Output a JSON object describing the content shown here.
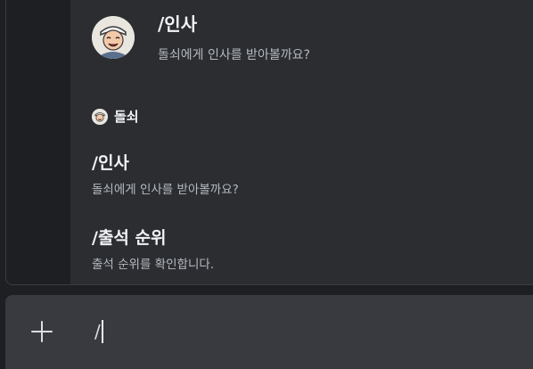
{
  "autocomplete": {
    "featured": {
      "command": "/인사",
      "description": "돌쇠에게 인사를 받아볼까요?",
      "avatar_icon": "bot-avatar-icon"
    },
    "bot": {
      "name": "돌쇠",
      "avatar_icon": "bot-avatar-icon"
    },
    "commands": [
      {
        "command": "/인사",
        "description": "돌쇠에게 인사를 받아볼까요?"
      },
      {
        "command": "/출석 순위",
        "description": "출석 순위를 확인합니다."
      }
    ]
  },
  "composer": {
    "add_icon": "plus-icon",
    "value": "/"
  },
  "colors": {
    "background": "#1e1f22",
    "panel": "#2b2d31",
    "input": "#383a40",
    "text": "#f2f3f5",
    "muted": "#b5bac1"
  }
}
